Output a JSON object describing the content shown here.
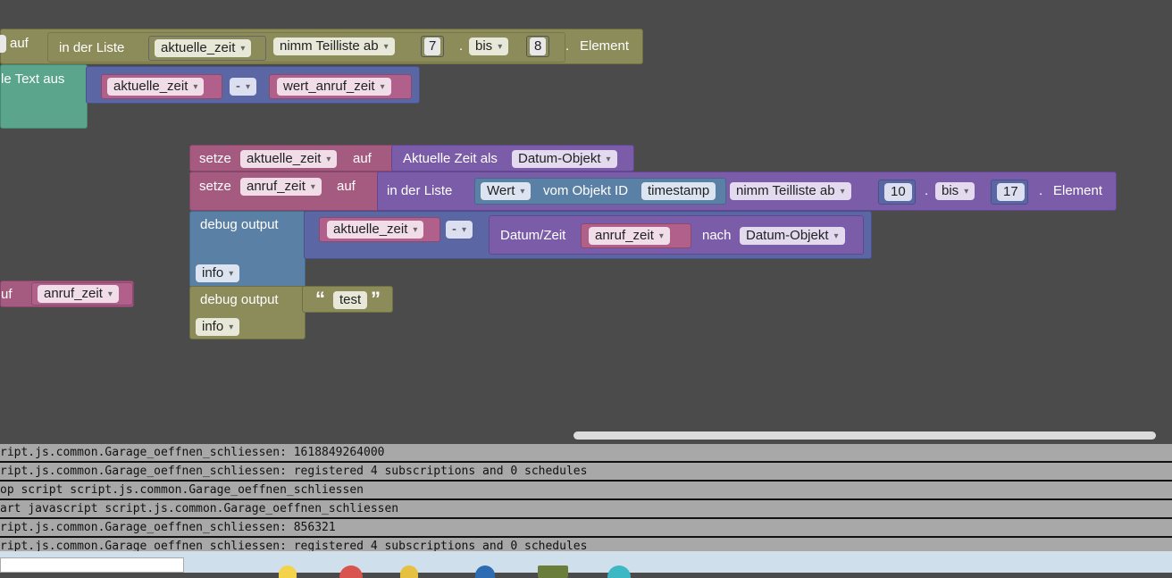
{
  "workspace": {
    "block1": {
      "auf": "auf",
      "in_der_liste": "in der Liste",
      "var": "aktuelle_zeit",
      "mode": "nimm Teilliste ab",
      "from": "7",
      "bis": "bis",
      "to": "8",
      "element": "Element"
    },
    "block2": {
      "label": "le Text aus",
      "var1": "aktuelle_zeit",
      "op": "-",
      "var2": "wert_anruf_zeit"
    },
    "block3": {
      "setze": "setze",
      "var": "aktuelle_zeit",
      "auf": "auf",
      "value": "Aktuelle Zeit als",
      "format": "Datum-Objekt"
    },
    "block4": {
      "setze": "setze",
      "var": "anruf_zeit",
      "auf": "auf",
      "in_der_liste": "in der Liste",
      "wert": "Wert",
      "vom_objekt": "vom Objekt ID",
      "object_id": "timestamp",
      "mode": "nimm Teilliste ab",
      "from": "10",
      "bis": "bis",
      "to": "17",
      "element": "Element"
    },
    "block5": {
      "label": "debug output",
      "var1": "aktuelle_zeit",
      "op": "-",
      "datum_zeit": "Datum/Zeit",
      "var2": "anruf_zeit",
      "nach": "nach",
      "format": "Datum-Objekt",
      "level": "info"
    },
    "block6": {
      "uf": "uf",
      "var": "anruf_zeit"
    },
    "block7": {
      "label": "debug output",
      "open_quote": "“",
      "text": "test",
      "close_quote": "”",
      "level": "info"
    }
  },
  "console": {
    "rows": [
      "ript.js.common.Garage_oeffnen_schliessen: 1618849264000",
      "ript.js.common.Garage_oeffnen_schliessen: registered 4 subscriptions and 0 schedules",
      "op script script.js.common.Garage_oeffnen_schliessen",
      "art javascript script.js.common.Garage_oeffnen_schliessen",
      "ript.js.common.Garage_oeffnen_schliessen: 856321",
      "ript.js.common.Garage_oeffnen_schliessen: registered 4 subscriptions and 0 schedules"
    ]
  },
  "colors": {
    "workspace_bg": "#4b4b4b",
    "olive": "#8c8c5a",
    "green": "#5ba58c",
    "pink": "#a55b80",
    "violet": "#7b5ca8",
    "blue": "#5b80a5"
  }
}
